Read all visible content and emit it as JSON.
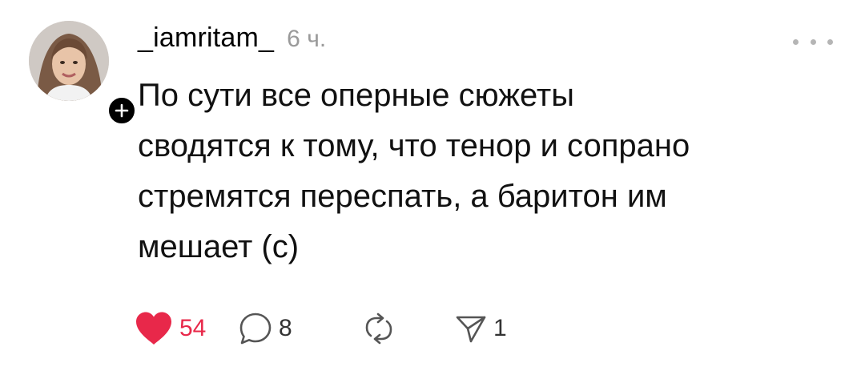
{
  "post": {
    "username": "_iamritam_",
    "timestamp": "6 ч.",
    "text": "По сути все оперные сюжеты\nсводятся к тому, что тенор и сопрано\nстремятся переспать, а баритон им\nмешает (с)",
    "likes": "54",
    "comments": "8",
    "shares": "1",
    "liked": true
  },
  "icons": {
    "avatar": "user-avatar-photo",
    "follow": "plus-icon",
    "more": "more-horizontal-icon",
    "like": "heart-filled-icon",
    "comment": "comment-bubble-icon",
    "repost": "repost-icon",
    "share": "send-icon"
  },
  "colors": {
    "like_red": "#e8284a",
    "timestamp_gray": "#9a9a9a",
    "icon_gray": "#555555"
  }
}
